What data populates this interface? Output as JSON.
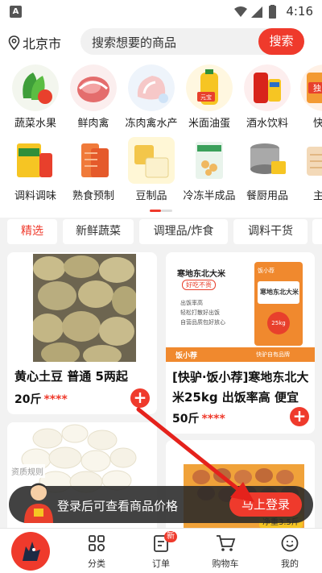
{
  "status_bar": {
    "time": "4:16",
    "sim_letter": "A"
  },
  "location": {
    "city": "北京市"
  },
  "search": {
    "placeholder": "搜索想要的商品",
    "button": "搜索"
  },
  "categories_row1": [
    {
      "label": "蔬菜水果",
      "icon": "vegetable-icon"
    },
    {
      "label": "鲜肉禽",
      "icon": "meat-icon"
    },
    {
      "label": "冻肉禽水产",
      "icon": "frozen-meat-icon"
    },
    {
      "label": "米面油蛋",
      "icon": "oil-icon",
      "sticker": "元宝"
    },
    {
      "label": "酒水饮料",
      "icon": "drink-icon"
    },
    {
      "label": "快驴",
      "icon": "kuailv-icon",
      "sticker": "独"
    }
  ],
  "categories_row2": [
    {
      "label": "调料调味",
      "icon": "seasoning-icon"
    },
    {
      "label": "熟食预制",
      "icon": "prepared-food-icon"
    },
    {
      "label": "豆制品",
      "icon": "tofu-icon"
    },
    {
      "label": "冷冻半成品",
      "icon": "frozen-food-icon"
    },
    {
      "label": "餐厨用品",
      "icon": "kitchenware-icon"
    },
    {
      "label": "主食",
      "icon": "staple-food-icon"
    }
  ],
  "tabs": [
    "精选",
    "新鲜蔬菜",
    "调理品/炸食",
    "调料干货"
  ],
  "products": [
    {
      "title": "黄心土豆 普通 5两起",
      "unit_price": "20斤",
      "stars": "****"
    },
    {
      "title": "[快驴·饭小荐]寒地东北大米25kg 出饭率高 便宜",
      "unit_price": "50斤",
      "stars": "****",
      "image_text": {
        "headline": "寒地东北大米",
        "sub": "好吃不贵",
        "points": [
          "出饭率高",
          "轻松打散好出饭",
          "自营品质包好放心"
        ],
        "bag_brand": "饭小荐",
        "bag_name": "寒地东北大米",
        "bag_weight": "25kg",
        "footer_left": "饭小荐",
        "footer_right": "快驴自有品牌"
      }
    },
    {
      "title": "",
      "label": "资质规则"
    },
    {
      "title": "",
      "price_tag": "净重3.5斤"
    }
  ],
  "login_banner": {
    "text": "登录后可查看商品价格",
    "button": "马上登录"
  },
  "bottom_nav": [
    {
      "label": "",
      "icon": "kuailv-logo-icon"
    },
    {
      "label": "分类",
      "icon": "grid-icon"
    },
    {
      "label": "订单",
      "icon": "order-icon",
      "badge": "新"
    },
    {
      "label": "购物车",
      "icon": "cart-icon"
    },
    {
      "label": "我的",
      "icon": "profile-icon"
    }
  ],
  "colors": {
    "accent": "#ef3a2c",
    "background": "#f2f2f2",
    "card": "#ffffff"
  }
}
